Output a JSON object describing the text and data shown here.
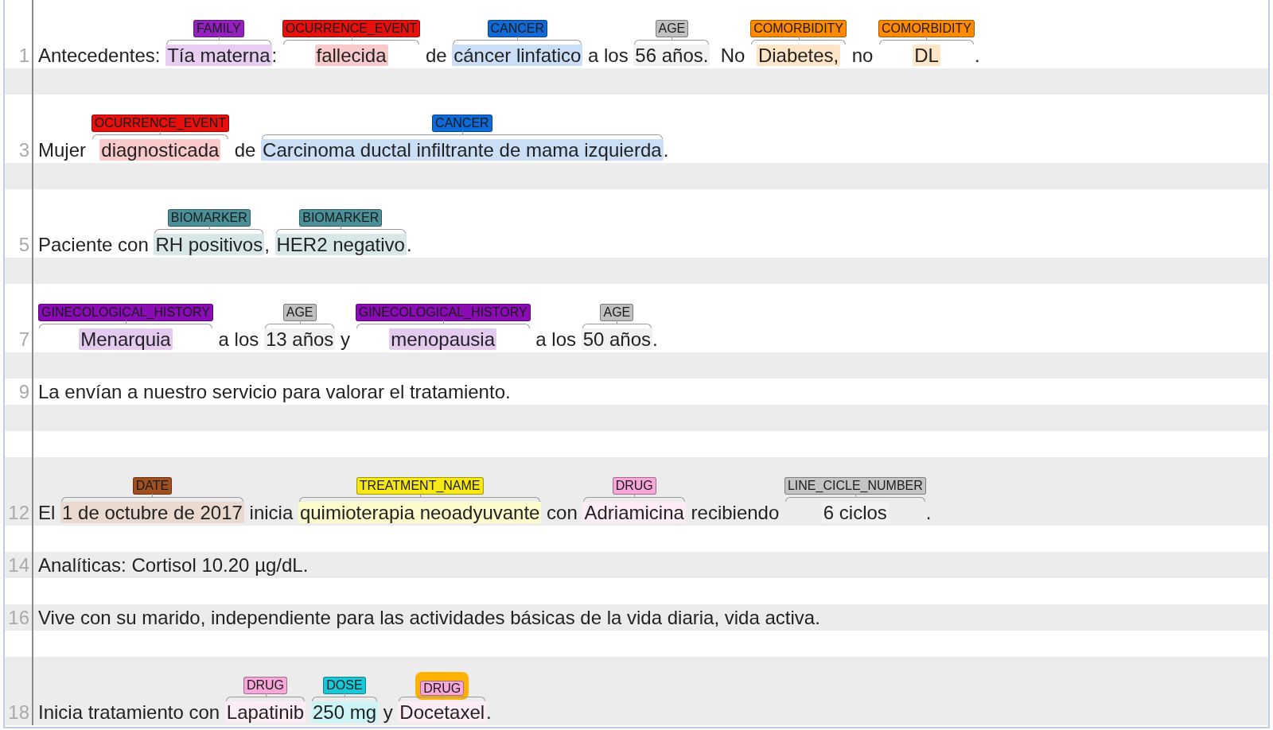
{
  "rows": [
    {
      "number": "1",
      "segments": [
        {
          "text": "Antecedentes: "
        },
        {
          "text": "Tía materna",
          "label": "FAMILY",
          "color": "#9420c0",
          "selected": false
        },
        {
          "text": ": "
        },
        {
          "text": "fallecida",
          "label": "OCURRENCE_EVENT",
          "color": "#e8100c",
          "selected": false
        },
        {
          "text": " de "
        },
        {
          "text": "cáncer linfatico",
          "label": "CANCER",
          "color": "#0f6ad8",
          "selected": false
        },
        {
          "text": " a los "
        },
        {
          "text": "56 años.",
          "label": "AGE",
          "color": "#c0c0c0",
          "selected": false
        },
        {
          "text": "  No "
        },
        {
          "text": "Diabetes,",
          "label": "COMORBIDITY",
          "color": "#ff8a00",
          "selected": false
        },
        {
          "text": " no "
        },
        {
          "text": "DL",
          "label": "COMORBIDITY",
          "color": "#ff8a00",
          "selected": false
        },
        {
          "text": "."
        }
      ]
    },
    {
      "segments": []
    },
    {
      "number": "3",
      "segments": [
        {
          "text": "Mujer "
        },
        {
          "text": "diagnosticada",
          "label": "OCURRENCE_EVENT",
          "color": "#e8100c",
          "selected": false
        },
        {
          "text": " de "
        },
        {
          "text": "Carcinoma ductal infiltrante de mama izquierda",
          "label": "CANCER",
          "color": "#0f6ad8",
          "selected": false
        },
        {
          "text": "."
        }
      ]
    },
    {
      "segments": []
    },
    {
      "number": "5",
      "segments": [
        {
          "text": "Paciente con "
        },
        {
          "text": "RH positivos",
          "label": "BIOMARKER",
          "color": "#4a9098",
          "selected": false
        },
        {
          "text": ", "
        },
        {
          "text": "HER2 negativo",
          "label": "BIOMARKER",
          "color": "#4a9098",
          "selected": false
        },
        {
          "text": "."
        }
      ]
    },
    {
      "segments": []
    },
    {
      "number": "7",
      "segments": [
        {
          "text": "Menarquia",
          "label": "GINECOLOGICAL_HISTORY",
          "color": "#8a0cb4",
          "selected": false
        },
        {
          "text": " a los "
        },
        {
          "text": "13 años",
          "label": "AGE",
          "color": "#c0c0c0",
          "selected": false
        },
        {
          "text": " y "
        },
        {
          "text": "menopausia",
          "label": "GINECOLOGICAL_HISTORY",
          "color": "#8a0cb4",
          "selected": false
        },
        {
          "text": " a los "
        },
        {
          "text": "50 años",
          "label": "AGE",
          "color": "#c0c0c0",
          "selected": false
        },
        {
          "text": "."
        }
      ]
    },
    {
      "segments": []
    },
    {
      "number": "9",
      "segments": [
        {
          "text": "La envían a nuestro servicio para valorar el tratamiento."
        }
      ]
    },
    {
      "segments": []
    },
    {
      "segments": []
    },
    {
      "number": "12",
      "segments": [
        {
          "text": "El "
        },
        {
          "text": "1 de octubre de 2017",
          "label": "DATE",
          "color": "#a0501e",
          "selected": false
        },
        {
          "text": " inicia "
        },
        {
          "text": "quimioterapia neoadyuvante",
          "label": "TREATMENT_NAME",
          "color": "#f6e814",
          "selected": false
        },
        {
          "text": " con "
        },
        {
          "text": "Adriamicina",
          "label": "DRUG",
          "color": "#f7a8d8",
          "selected": false
        },
        {
          "text": " recibiendo "
        },
        {
          "text": "6 ciclos",
          "label": "LINE_CICLE_NUMBER",
          "color": "#c4c4c4",
          "selected": false
        },
        {
          "text": "."
        }
      ]
    },
    {
      "segments": []
    },
    {
      "number": "14",
      "segments": [
        {
          "text": "Analíticas: Cortisol 10.20 µg/dL."
        }
      ]
    },
    {
      "segments": []
    },
    {
      "number": "16",
      "segments": [
        {
          "text": "Vive con su marido, independiente para las actividades básicas de la vida diaria, vida activa."
        }
      ]
    },
    {
      "segments": []
    },
    {
      "number": "18",
      "segments": [
        {
          "text": "Inicia tratamiento con "
        },
        {
          "text": "Lapatinib",
          "label": "DRUG",
          "color": "#f7a8d8",
          "selected": false
        },
        {
          "text": "250 mg",
          "label": "DOSE",
          "color": "#18c8d8",
          "selected": false
        },
        {
          "text": " y "
        },
        {
          "text": "Docetaxel",
          "label": "DRUG",
          "color": "#f7a8d8",
          "selected": true
        },
        {
          "text": "."
        }
      ]
    }
  ]
}
